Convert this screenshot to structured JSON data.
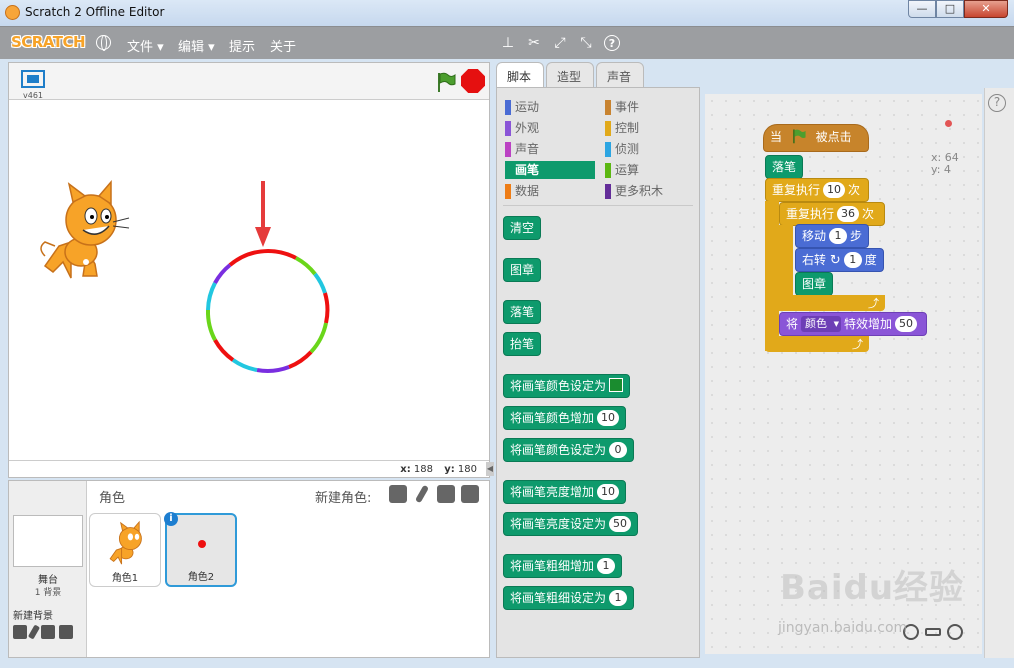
{
  "window": {
    "title": "Scratch 2 Offline Editor"
  },
  "menubar": {
    "logo": "SCRATCH",
    "items": [
      "文件 ▾",
      "编辑 ▾",
      "提示",
      "关于"
    ]
  },
  "stage": {
    "version": "v461",
    "mouse_x_label": "x:",
    "mouse_x": "188",
    "mouse_y_label": "y:",
    "mouse_y": "180"
  },
  "sprites": {
    "header": "角色",
    "new_sprite_label": "新建角色:",
    "stage_label": "舞台",
    "stage_sub": "1 背景",
    "new_backdrop_label": "新建背景",
    "items": [
      {
        "name": "角色1"
      },
      {
        "name": "角色2"
      }
    ]
  },
  "tabs": [
    "脚本",
    "造型",
    "声音"
  ],
  "palette": {
    "categories_left": [
      {
        "label": "运动",
        "color": "#4a6cd4"
      },
      {
        "label": "外观",
        "color": "#8a55d7"
      },
      {
        "label": "声音",
        "color": "#bb42c3"
      },
      {
        "label": "画笔",
        "color": "#0e9a6c",
        "active": true
      },
      {
        "label": "数据",
        "color": "#ee7d16"
      }
    ],
    "categories_right": [
      {
        "label": "事件",
        "color": "#c88330"
      },
      {
        "label": "控制",
        "color": "#e1a91a"
      },
      {
        "label": "侦测",
        "color": "#2ca5e2"
      },
      {
        "label": "运算",
        "color": "#5cb712"
      },
      {
        "label": "更多积木",
        "color": "#632d99"
      }
    ],
    "blocks": [
      {
        "text": "清空"
      },
      {
        "text": "图章"
      },
      {
        "text": "落笔"
      },
      {
        "text": "抬笔"
      },
      {
        "text": "将画笔颜色设定为",
        "swatch": true
      },
      {
        "text": "将画笔颜色增加",
        "num": "10"
      },
      {
        "text": "将画笔颜色设定为",
        "num": "0"
      },
      {
        "text": "将画笔亮度增加",
        "num": "10"
      },
      {
        "text": "将画笔亮度设定为",
        "num": "50"
      },
      {
        "text": "将画笔粗细增加",
        "num": "1"
      },
      {
        "text": "将画笔粗细设定为",
        "num": "1"
      }
    ]
  },
  "script": {
    "hat_when": "当",
    "hat_clicked": "被点击",
    "pen_down": "落笔",
    "repeat_label": "重复执行",
    "repeat_outer": "10",
    "times": "次",
    "repeat_inner": "36",
    "move_label": "移动",
    "move_steps": "1",
    "move_unit": "步",
    "turn_label": "右转",
    "turn_deg": "1",
    "turn_unit": "度",
    "stamp": "图章",
    "effect_prefix": "将",
    "effect_name": "颜色",
    "effect_suffix": "特效增加",
    "effect_value": "50",
    "x": "x: 64",
    "y": "y: 4"
  },
  "watermark": {
    "text": "Baidu经验",
    "sub": "jingyan.baidu.com"
  }
}
